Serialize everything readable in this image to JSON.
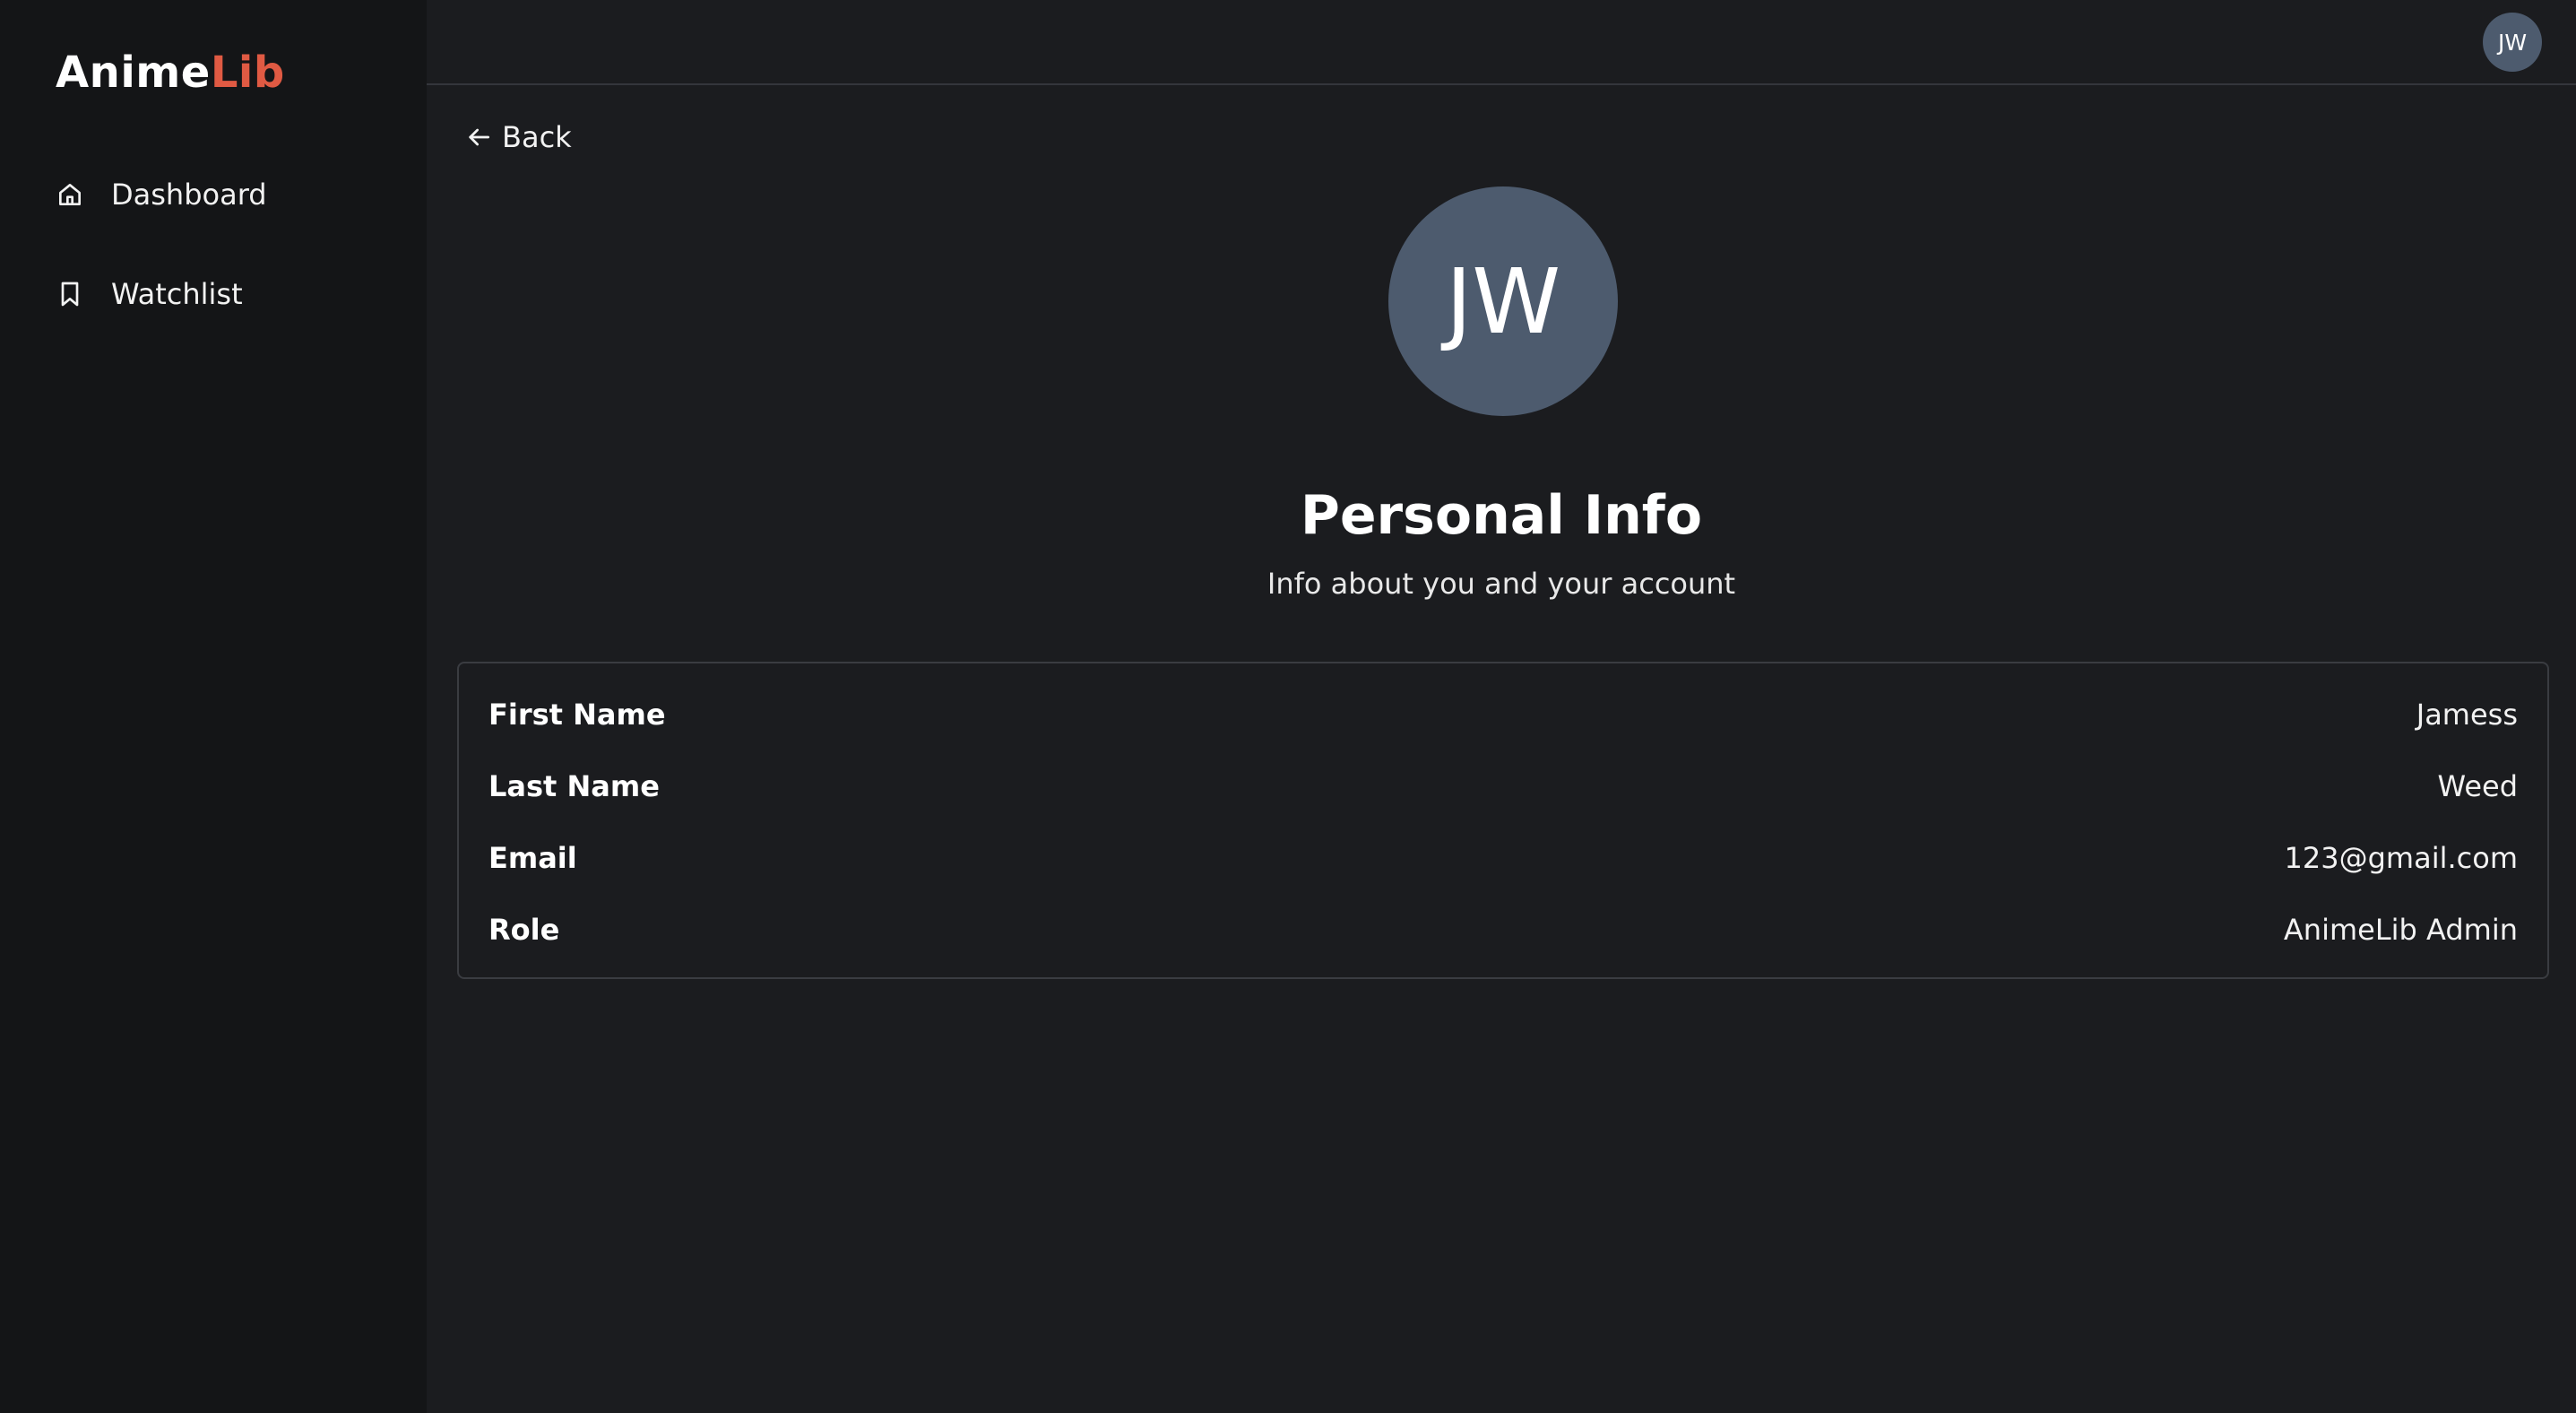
{
  "sidebar": {
    "logo_part1": "Anime",
    "logo_part2": "Lib",
    "items": [
      {
        "label": "Dashboard",
        "icon": "home-icon"
      },
      {
        "label": "Watchlist",
        "icon": "bookmark-icon"
      }
    ]
  },
  "header": {
    "avatar_initials": "JW"
  },
  "main": {
    "back_label": "Back",
    "avatar_initials": "JW",
    "title": "Personal Info",
    "subtitle": "Info about you and your account",
    "fields": [
      {
        "label": "First Name",
        "value": "Jamess"
      },
      {
        "label": "Last Name",
        "value": "Weed"
      },
      {
        "label": "Email",
        "value": "123@gmail.com"
      },
      {
        "label": "Role",
        "value": "AnimeLib Admin"
      }
    ]
  },
  "colors": {
    "background": "#1b1c1f",
    "sidebar": "#141517",
    "accent": "#e05a43",
    "avatar": "#4d5b6e"
  }
}
